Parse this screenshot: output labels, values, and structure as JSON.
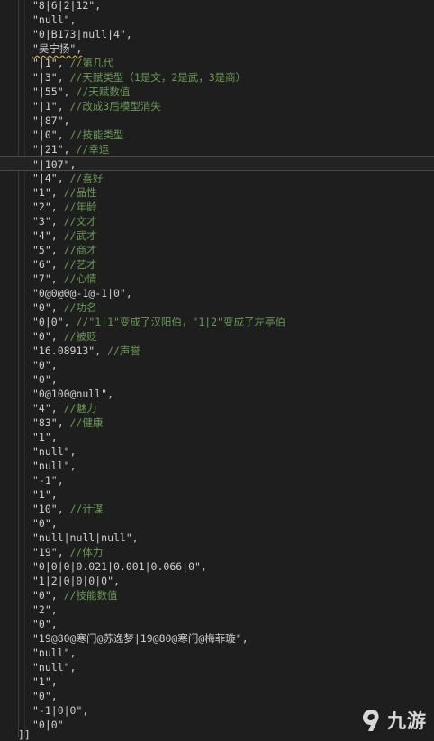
{
  "lines": [
    {
      "code": "\"8|6|2|12\",",
      "comment": ""
    },
    {
      "code": "\"null\",",
      "comment": ""
    },
    {
      "code": "\"0|B173|null|4\",",
      "comment": ""
    },
    {
      "code": "\"吴宁扬\",",
      "comment": ""
    },
    {
      "code": "\"|1\", ",
      "comment": "//第几代"
    },
    {
      "code": "\"|3\", ",
      "comment": "//天赋类型（1是文，2是武，3是商）"
    },
    {
      "code": "\"|55\", ",
      "comment": "//天赋数值"
    },
    {
      "code": "\"|1\", ",
      "comment": "//改成3后模型消失"
    },
    {
      "code": "\"|87\",",
      "comment": ""
    },
    {
      "code": "\"|0\", ",
      "comment": "//技能类型"
    },
    {
      "code": "\"|21\", ",
      "comment": "//幸运"
    },
    {
      "code": "\"|107\",",
      "comment": ""
    },
    {
      "code": "\"|4\", ",
      "comment": "//喜好"
    },
    {
      "code": "\"1\", ",
      "comment": "//品性"
    },
    {
      "code": "\"2\", ",
      "comment": "//年龄"
    },
    {
      "code": "\"3\", ",
      "comment": "//文才"
    },
    {
      "code": "\"4\", ",
      "comment": "//武才"
    },
    {
      "code": "\"5\", ",
      "comment": "//商才"
    },
    {
      "code": "\"6\", ",
      "comment": "//艺才"
    },
    {
      "code": "\"7\", ",
      "comment": "//心情"
    },
    {
      "code": "\"0@0@0@-1@-1|0\",",
      "comment": ""
    },
    {
      "code": "\"0\", ",
      "comment": "//功名"
    },
    {
      "code": "\"0|0\", ",
      "comment": "//\"1|1\"变成了汉阳伯，\"1|2\"变成了左亭伯"
    },
    {
      "code": "\"0\", ",
      "comment": "//被贬"
    },
    {
      "code": "\"16.08913\", ",
      "comment": "//声誉"
    },
    {
      "code": "\"0\",",
      "comment": ""
    },
    {
      "code": "\"0\",",
      "comment": ""
    },
    {
      "code": "\"0@100@null\",",
      "comment": ""
    },
    {
      "code": "\"4\", ",
      "comment": "//魅力"
    },
    {
      "code": "\"83\", ",
      "comment": "//健康"
    },
    {
      "code": "\"1\",",
      "comment": ""
    },
    {
      "code": "\"null\",",
      "comment": ""
    },
    {
      "code": "\"null\",",
      "comment": ""
    },
    {
      "code": "\"-1\",",
      "comment": ""
    },
    {
      "code": "\"1\",",
      "comment": ""
    },
    {
      "code": "\"10\", ",
      "comment": "//计谋"
    },
    {
      "code": "\"0\",",
      "comment": ""
    },
    {
      "code": "\"null|null|null\",",
      "comment": ""
    },
    {
      "code": "\"19\", ",
      "comment": "//体力"
    },
    {
      "code": "\"0|0|0|0.021|0.001|0.066|0\",",
      "comment": ""
    },
    {
      "code": "\"1|2|0|0|0|0\",",
      "comment": ""
    },
    {
      "code": "\"0\", ",
      "comment": "//技能数值"
    },
    {
      "code": "\"2\",",
      "comment": ""
    },
    {
      "code": "\"0\",",
      "comment": ""
    },
    {
      "code": "\"19@80@寒门@苏逸梦|19@80@寒门@梅菲璇\",",
      "comment": ""
    },
    {
      "code": "\"null\",",
      "comment": ""
    },
    {
      "code": "\"null\",",
      "comment": ""
    },
    {
      "code": "\"1\",",
      "comment": ""
    },
    {
      "code": "\"0\",",
      "comment": ""
    },
    {
      "code": "\"-1|0|0\",",
      "comment": ""
    },
    {
      "code": "\"0|0\"",
      "comment": ""
    }
  ],
  "closing_bracket": "]]",
  "watermark": {
    "text": "九游",
    "icon": "nine-game-logo-icon"
  }
}
